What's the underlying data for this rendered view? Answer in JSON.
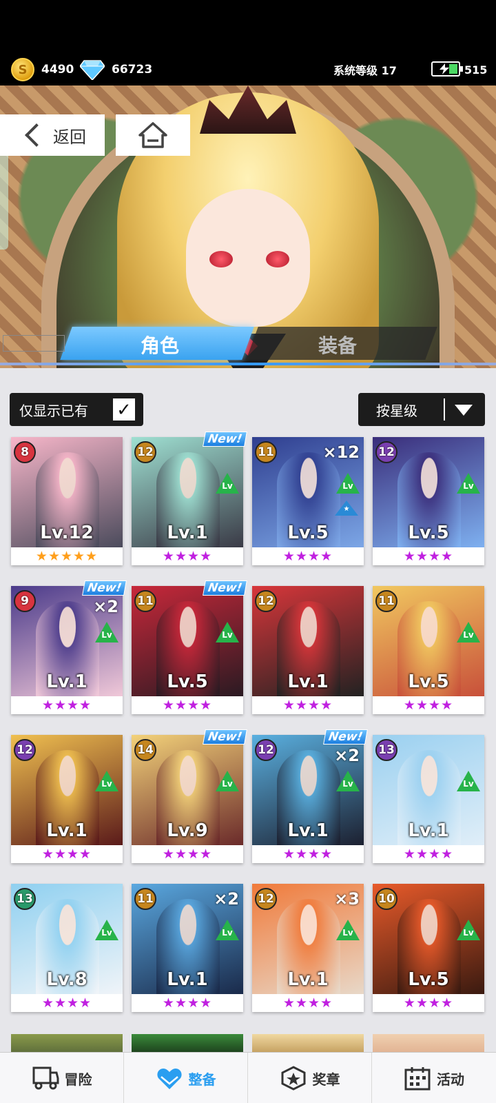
{
  "topbar": {
    "gold": "4490",
    "diamonds": "66723",
    "system_level": "系统等级 17",
    "energy": "515"
  },
  "header": {
    "back_label": "返回"
  },
  "tabs": [
    {
      "label": "角色",
      "active": true
    },
    {
      "label": "装备",
      "active": false
    }
  ],
  "filters": {
    "owned_label": "仅显示已有",
    "owned_checked": "✓",
    "sort_label": "按星级"
  },
  "characters": [
    {
      "tier": "8",
      "level": "Lv.12",
      "stars": "★★★★★",
      "star_color": "#ff9f1c",
      "badge_color": "#d8343f",
      "new": false,
      "dup": "",
      "lv_up": false,
      "star_up": false,
      "art": [
        "#f7b6c9",
        "#4b4b5c"
      ]
    },
    {
      "tier": "12",
      "level": "Lv.1",
      "stars": "★★★★",
      "star_color": "#c020e0",
      "badge_color": "#c6861e",
      "new": true,
      "dup": "",
      "lv_up": true,
      "star_up": false,
      "art": [
        "#9fe0d2",
        "#3a3a46"
      ]
    },
    {
      "tier": "11",
      "level": "Lv.5",
      "stars": "★★★★",
      "star_color": "#c020e0",
      "badge_color": "#c6861e",
      "new": false,
      "dup": "×12",
      "lv_up": true,
      "star_up": true,
      "art": [
        "#2f3e8f",
        "#7ca6e6"
      ]
    },
    {
      "tier": "12",
      "level": "Lv.5",
      "stars": "★★★★",
      "star_color": "#c020e0",
      "badge_color": "#7a3fb0",
      "new": false,
      "dup": "",
      "lv_up": true,
      "star_up": false,
      "art": [
        "#3a2d7a",
        "#7eb0f0"
      ]
    },
    {
      "tier": "9",
      "level": "Lv.1",
      "stars": "★★★★",
      "star_color": "#c020e0",
      "badge_color": "#d8343f",
      "new": true,
      "dup": "×2",
      "lv_up": true,
      "star_up": false,
      "art": [
        "#4a3a8a",
        "#f0c8d8"
      ]
    },
    {
      "tier": "11",
      "level": "Lv.5",
      "stars": "★★★★",
      "star_color": "#c020e0",
      "badge_color": "#c6861e",
      "new": true,
      "dup": "",
      "lv_up": true,
      "star_up": false,
      "art": [
        "#c8283a",
        "#2a1a22"
      ]
    },
    {
      "tier": "12",
      "level": "Lv.1",
      "stars": "★★★★",
      "star_color": "#c020e0",
      "badge_color": "#c6861e",
      "new": false,
      "dup": "",
      "lv_up": false,
      "star_up": false,
      "art": [
        "#d8363a",
        "#222"
      ]
    },
    {
      "tier": "11",
      "level": "Lv.5",
      "stars": "★★★★",
      "star_color": "#c020e0",
      "badge_color": "#c6861e",
      "new": false,
      "dup": "",
      "lv_up": true,
      "star_up": false,
      "art": [
        "#f1c860",
        "#c8503a"
      ]
    },
    {
      "tier": "12",
      "level": "Lv.1",
      "stars": "★★★★",
      "star_color": "#c020e0",
      "badge_color": "#7a3fb0",
      "new": false,
      "dup": "",
      "lv_up": true,
      "star_up": false,
      "art": [
        "#f0c050",
        "#5a1a1a"
      ]
    },
    {
      "tier": "14",
      "level": "Lv.9",
      "stars": "★★★★",
      "star_color": "#c020e0",
      "badge_color": "#c6861e",
      "new": true,
      "dup": "",
      "lv_up": true,
      "star_up": false,
      "art": [
        "#f3d27a",
        "#6a2a2a"
      ]
    },
    {
      "tier": "12",
      "level": "Lv.1",
      "stars": "★★★★",
      "star_color": "#c020e0",
      "badge_color": "#7a3fb0",
      "new": true,
      "dup": "×2",
      "lv_up": true,
      "star_up": false,
      "art": [
        "#5ab0e0",
        "#1c2030"
      ]
    },
    {
      "tier": "13",
      "level": "Lv.1",
      "stars": "★★★★",
      "star_color": "#c020e0",
      "badge_color": "#7a3fb0",
      "new": false,
      "dup": "",
      "lv_up": true,
      "star_up": false,
      "art": [
        "#9ad0f0",
        "#e0eef8"
      ]
    },
    {
      "tier": "13",
      "level": "Lv.8",
      "stars": "★★★★",
      "star_color": "#c020e0",
      "badge_color": "#2a9a6a",
      "new": false,
      "dup": "",
      "lv_up": true,
      "star_up": false,
      "art": [
        "#8fd0f0",
        "#f0f4f8"
      ]
    },
    {
      "tier": "11",
      "level": "Lv.1",
      "stars": "★★★★",
      "star_color": "#c020e0",
      "badge_color": "#c6861e",
      "new": false,
      "dup": "×2",
      "lv_up": true,
      "star_up": false,
      "art": [
        "#5aa8e0",
        "#1a2a4a"
      ]
    },
    {
      "tier": "12",
      "level": "Lv.1",
      "stars": "★★★★",
      "star_color": "#c020e0",
      "badge_color": "#c6861e",
      "new": false,
      "dup": "×3",
      "lv_up": true,
      "star_up": false,
      "art": [
        "#f07a3a",
        "#e8d8c8"
      ]
    },
    {
      "tier": "10",
      "level": "Lv.5",
      "stars": "★★★★",
      "star_color": "#c020e0",
      "badge_color": "#c6861e",
      "new": false,
      "dup": "",
      "lv_up": true,
      "star_up": false,
      "art": [
        "#e85a2a",
        "#3a1a10"
      ]
    }
  ],
  "bottom_nav": [
    {
      "label": "冒险",
      "icon": "truck-icon",
      "active": false
    },
    {
      "label": "整备",
      "icon": "heart-shield-icon",
      "active": true
    },
    {
      "label": "奖章",
      "icon": "medal-icon",
      "active": false
    },
    {
      "label": "活动",
      "icon": "calendar-icon",
      "active": false
    }
  ]
}
